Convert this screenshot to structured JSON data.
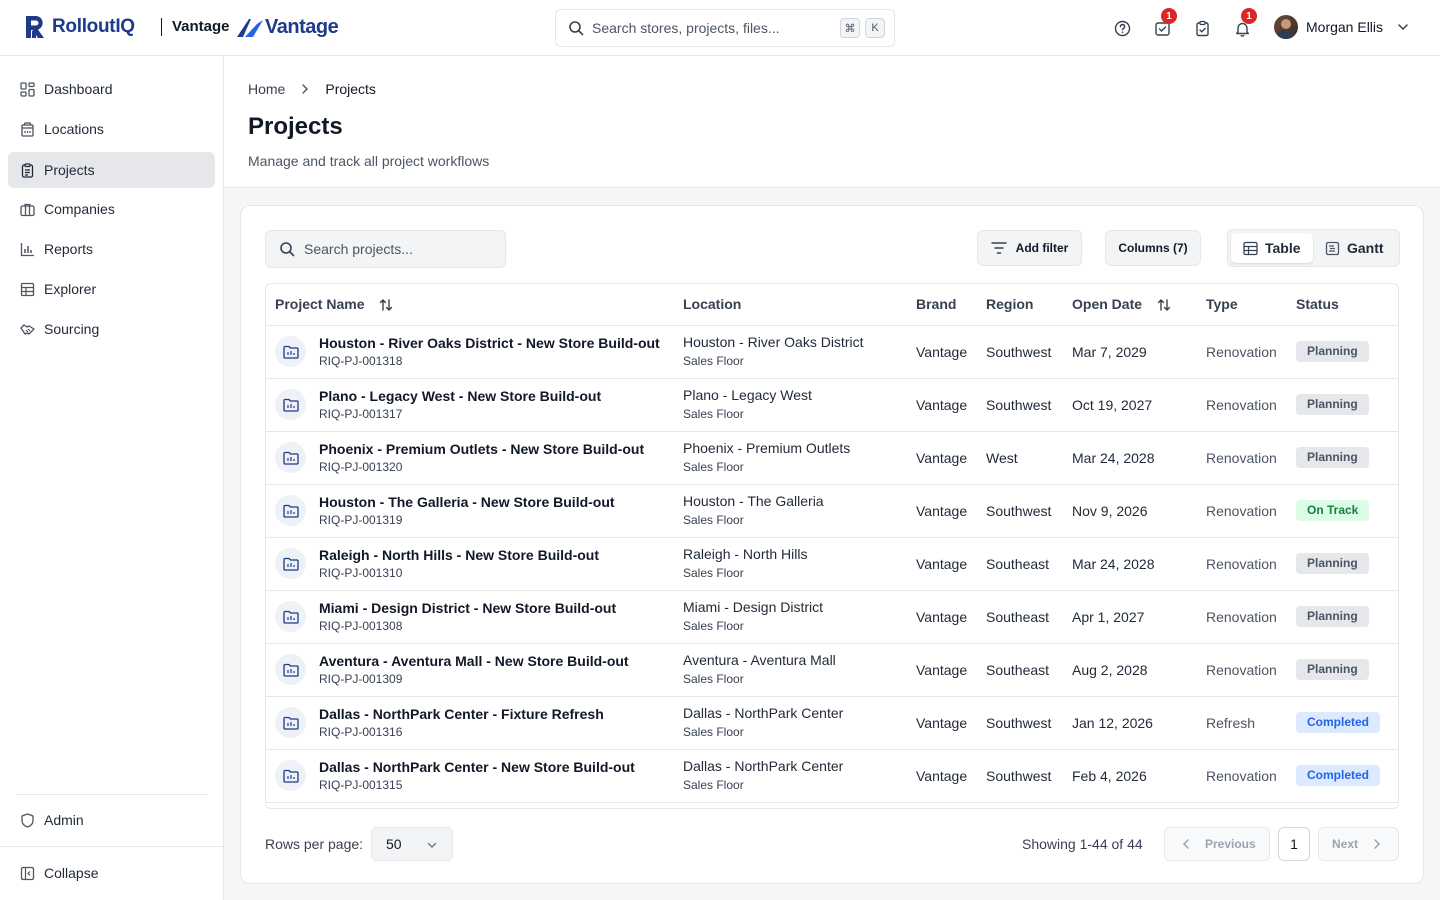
{
  "header": {
    "app_name": "RolloutIQ",
    "brand_label": "Vantage",
    "brand_logo_text": "Vantage",
    "search_placeholder": "Search stores, projects, files...",
    "shortcut_keys": [
      "⌘",
      "K"
    ],
    "notifications": {
      "tasks_badge": "1",
      "bell_badge": "1"
    },
    "user_name": "Morgan Ellis"
  },
  "sidebar": {
    "items": [
      {
        "label": "Dashboard",
        "icon": "dashboard-icon"
      },
      {
        "label": "Locations",
        "icon": "building-icon"
      },
      {
        "label": "Projects",
        "icon": "clipboard-icon",
        "active": true
      },
      {
        "label": "Companies",
        "icon": "briefcase-icon"
      },
      {
        "label": "Reports",
        "icon": "bar-chart-icon"
      },
      {
        "label": "Explorer",
        "icon": "table-icon"
      },
      {
        "label": "Sourcing",
        "icon": "handshake-icon"
      }
    ],
    "admin_label": "Admin",
    "collapse_label": "Collapse"
  },
  "page": {
    "breadcrumb": [
      "Home",
      "Projects"
    ],
    "title": "Projects",
    "subtitle": "Manage and track all project workflows"
  },
  "toolbar": {
    "search_placeholder": "Search projects...",
    "add_filter_label": "Add filter",
    "columns_label": "Columns (7)",
    "view_table_label": "Table",
    "view_gantt_label": "Gantt"
  },
  "table": {
    "columns": [
      "Project Name",
      "Location",
      "Brand",
      "Region",
      "Open Date",
      "Type",
      "Status"
    ],
    "rows": [
      {
        "name": "Houston - River Oaks District - New Store Build-out",
        "id": "RIQ-PJ-001318",
        "location": "Houston - River Oaks District",
        "area": "Sales Floor",
        "brand": "Vantage",
        "region": "Southwest",
        "open_date": "Mar 7, 2029",
        "type": "Renovation",
        "status": "Planning"
      },
      {
        "name": "Plano - Legacy West - New Store Build-out",
        "id": "RIQ-PJ-001317",
        "location": "Plano - Legacy West",
        "area": "Sales Floor",
        "brand": "Vantage",
        "region": "Southwest",
        "open_date": "Oct 19, 2027",
        "type": "Renovation",
        "status": "Planning"
      },
      {
        "name": "Phoenix - Premium Outlets - New Store Build-out",
        "id": "RIQ-PJ-001320",
        "location": "Phoenix - Premium Outlets",
        "area": "Sales Floor",
        "brand": "Vantage",
        "region": "West",
        "open_date": "Mar 24, 2028",
        "type": "Renovation",
        "status": "Planning"
      },
      {
        "name": "Houston - The Galleria - New Store Build-out",
        "id": "RIQ-PJ-001319",
        "location": "Houston - The Galleria",
        "area": "Sales Floor",
        "brand": "Vantage",
        "region": "Southwest",
        "open_date": "Nov 9, 2026",
        "type": "Renovation",
        "status": "On Track"
      },
      {
        "name": "Raleigh - North Hills - New Store Build-out",
        "id": "RIQ-PJ-001310",
        "location": "Raleigh - North Hills",
        "area": "Sales Floor",
        "brand": "Vantage",
        "region": "Southeast",
        "open_date": "Mar 24, 2028",
        "type": "Renovation",
        "status": "Planning"
      },
      {
        "name": "Miami - Design District - New Store Build-out",
        "id": "RIQ-PJ-001308",
        "location": "Miami - Design District",
        "area": "Sales Floor",
        "brand": "Vantage",
        "region": "Southeast",
        "open_date": "Apr 1, 2027",
        "type": "Renovation",
        "status": "Planning"
      },
      {
        "name": "Aventura - Aventura Mall - New Store Build-out",
        "id": "RIQ-PJ-001309",
        "location": "Aventura - Aventura Mall",
        "area": "Sales Floor",
        "brand": "Vantage",
        "region": "Southeast",
        "open_date": "Aug 2, 2028",
        "type": "Renovation",
        "status": "Planning"
      },
      {
        "name": "Dallas - NorthPark Center - Fixture Refresh",
        "id": "RIQ-PJ-001316",
        "location": "Dallas - NorthPark Center",
        "area": "Sales Floor",
        "brand": "Vantage",
        "region": "Southwest",
        "open_date": "Jan 12, 2026",
        "type": "Refresh",
        "status": "Completed"
      },
      {
        "name": "Dallas - NorthPark Center - New Store Build-out",
        "id": "RIQ-PJ-001315",
        "location": "Dallas - NorthPark Center",
        "area": "Sales Floor",
        "brand": "Vantage",
        "region": "Southwest",
        "open_date": "Feb 4, 2026",
        "type": "Renovation",
        "status": "Completed"
      }
    ]
  },
  "pagination": {
    "rows_per_page_label": "Rows per page:",
    "rows_per_page_value": "50",
    "showing_text": "Showing 1-44 of 44",
    "previous_label": "Previous",
    "current_page": "1",
    "next_label": "Next"
  },
  "colors": {
    "brand_navy": "#1e3a8a",
    "accent_blue": "#2563eb",
    "badge_red": "#dc2626",
    "status_planning_bg": "#e5e7eb",
    "status_on_track_bg": "#dcfce7",
    "status_completed_bg": "#dbeafe"
  }
}
